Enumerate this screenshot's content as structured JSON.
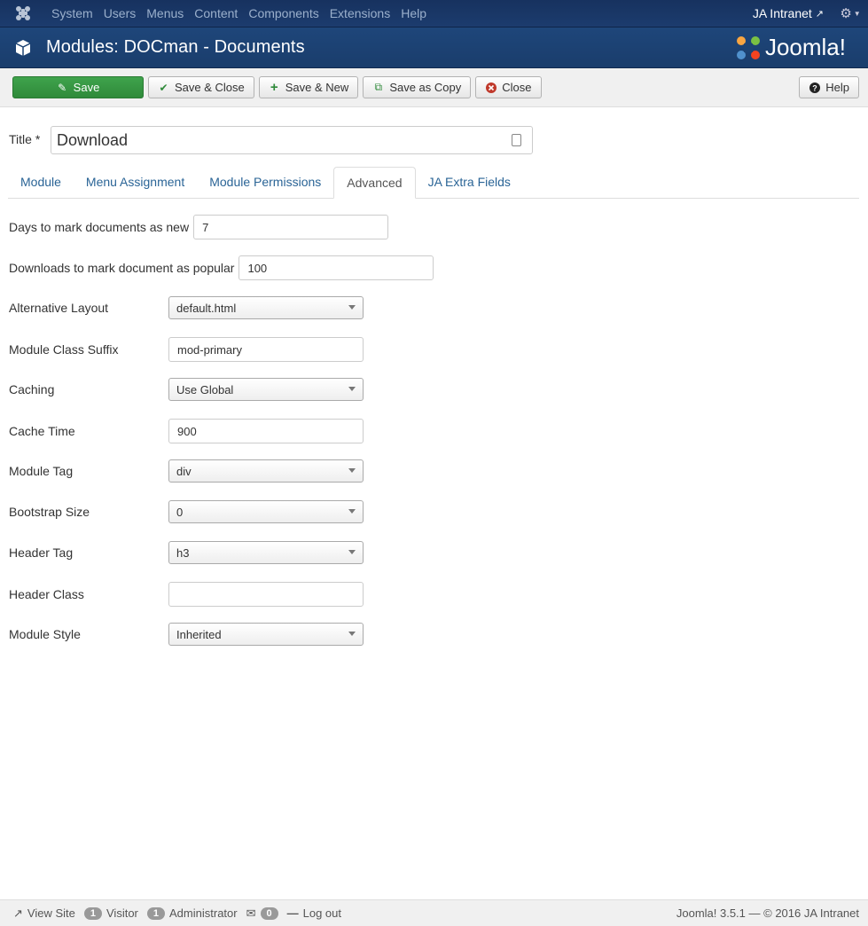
{
  "topnav": {
    "menu": [
      "System",
      "Users",
      "Menus",
      "Content",
      "Components",
      "Extensions",
      "Help"
    ],
    "site_name": "JA Intranet"
  },
  "header": {
    "title": "Modules: DOCman - Documents",
    "brand": "Joomla!"
  },
  "toolbar": {
    "save": "Save",
    "save_close": "Save & Close",
    "save_new": "Save & New",
    "save_copy": "Save as Copy",
    "close": "Close",
    "help": "Help"
  },
  "title_field": {
    "label": "Title *",
    "value": "Download"
  },
  "tabs": [
    "Module",
    "Menu Assignment",
    "Module Permissions",
    "Advanced",
    "JA Extra Fields"
  ],
  "active_tab": "Advanced",
  "form": {
    "days_new": {
      "label": "Days to mark documents as new",
      "value": "7"
    },
    "downloads_popular": {
      "label": "Downloads to mark document as popular",
      "value": "100"
    },
    "alt_layout": {
      "label": "Alternative Layout",
      "value": "default.html"
    },
    "class_suffix": {
      "label": "Module Class Suffix",
      "value": "mod-primary"
    },
    "caching": {
      "label": "Caching",
      "value": "Use Global"
    },
    "cache_time": {
      "label": "Cache Time",
      "value": "900"
    },
    "module_tag": {
      "label": "Module Tag",
      "value": "div"
    },
    "bootstrap_size": {
      "label": "Bootstrap Size",
      "value": "0"
    },
    "header_tag": {
      "label": "Header Tag",
      "value": "h3"
    },
    "header_class": {
      "label": "Header Class",
      "value": ""
    },
    "module_style": {
      "label": "Module Style",
      "value": "Inherited"
    }
  },
  "footer": {
    "view_site": "View Site",
    "visitor_count": "1",
    "visitor_label": "Visitor",
    "admin_count": "1",
    "admin_label": "Administrator",
    "messages_count": "0",
    "logout": "Log out",
    "version": "Joomla! 3.5.1  —  © 2016 JA Intranet"
  }
}
